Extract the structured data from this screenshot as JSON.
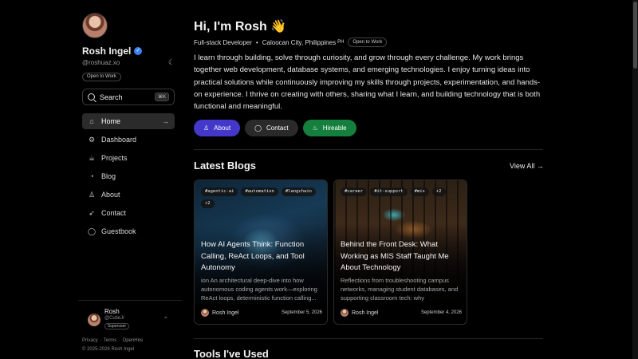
{
  "sidebar": {
    "name": "Rosh Ingel",
    "handle": "@roshuaz.xo",
    "badge": "Open to Work",
    "search": {
      "label": "Search",
      "shortcut": "⌘K"
    },
    "nav": [
      {
        "label": "Home",
        "icon": "home-icon",
        "active": true
      },
      {
        "label": "Dashboard",
        "icon": "dashboard-icon"
      },
      {
        "label": "Projects",
        "icon": "projects-icon"
      },
      {
        "label": "Blog",
        "icon": "blog-icon"
      },
      {
        "label": "About",
        "icon": "user-icon"
      },
      {
        "label": "Contact",
        "icon": "rocket-icon"
      },
      {
        "label": "Guestbook",
        "icon": "chat-icon"
      }
    ],
    "profile": {
      "name": "Rosh",
      "handle": "@CutieJr",
      "role": "Superuser"
    },
    "footer": {
      "privacy": "Privacy",
      "terms": "Terms",
      "openhire": "OpenHire",
      "copyright": "© 2025-2026 Rosh Ingel"
    }
  },
  "main": {
    "greeting": "Hi, I'm Rosh 👋",
    "role": "Full-stack Developer",
    "location": "Caloocan City, Philippines",
    "country_code": "PH",
    "status_badge": "Open to Work",
    "bio": "I learn through building, solve through curiosity, and grow through every challenge. My work brings together web development, database systems, and emerging technologies. I enjoy turning ideas into practical solutions while continuously improving my skills through projects, experimentation, and hands-on experience. I thrive on creating with others, sharing what I learn, and building technology that is both functional and meaningful.",
    "buttons": {
      "about": "About",
      "contact": "Contact",
      "hireable": "Hireable"
    },
    "blogs_title": "Latest Blogs",
    "view_all": "View All →",
    "blogs": [
      {
        "tags": [
          "#agentic-ai",
          "#automation",
          "#langchain",
          "+2"
        ],
        "title": "How AI Agents Think: Function Calling, ReAct Loops, and Tool Autonomy",
        "desc": "ion An architectural deep-dive into how autonomous coding agents work—exploring ReAct loops, deterministic function calling...",
        "author": "Rosh Ingel",
        "date": "September 5, 2026"
      },
      {
        "tags": [
          "#career",
          "#it-support",
          "#mis",
          "+2"
        ],
        "title": "Behind the Front Desk: What Working as MIS Staff Taught Me About Technology",
        "desc": "Reflections from troubleshooting campus networks, managing student databases, and supporting classroom tech: why",
        "author": "Rosh Ingel",
        "date": "September 4, 2026"
      }
    ],
    "tools_title": "Tools I've Used"
  },
  "colors": {
    "about_button": "#4338ca",
    "hireable_button": "#15803d",
    "verified": "#3b82f6"
  }
}
